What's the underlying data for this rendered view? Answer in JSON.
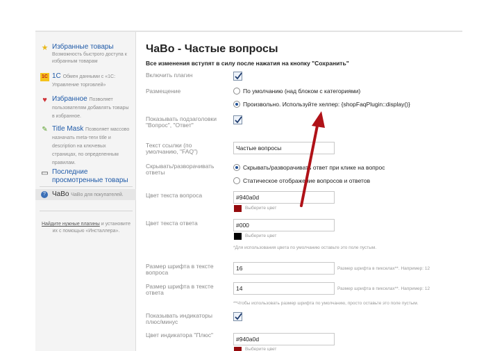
{
  "sidebar": {
    "items": [
      {
        "title": "Избранные товары",
        "desc": "Возможность быстрого доступа к избранным товарам",
        "icon": "star-icon"
      },
      {
        "title": "1С",
        "desc": "Обмен данными с «1С: Управление торговлей»",
        "icon": "1c-icon"
      },
      {
        "title": "Избранное",
        "desc": "Позволяет пользователям добавлять товары в избранное.",
        "icon": "heart-icon"
      },
      {
        "title": "Title Mask",
        "desc": "Позволяет массово назначать meta-теги title и description на ключевых страницах, по определенным правилам.",
        "icon": "mask-icon"
      },
      {
        "title": "Последние просмотренные товары",
        "desc": "",
        "icon": "monitor-icon"
      },
      {
        "title": "ЧаВо",
        "desc": "ЧаВо для покупателей.",
        "icon": "faq-icon"
      }
    ],
    "footer_link": "Найдите нужные плагины",
    "footer_text": "и установите их с помощью «Инсталлера»."
  },
  "main": {
    "title": "ЧаВо - Частые вопросы",
    "notice": "Все изменения вступят в силу после нажатия на кнопку \"Сохранить\"",
    "enable_label": "Включить плагин",
    "enable_checked": true,
    "placement_label": "Размещение",
    "placement_options": [
      "По умолчанию (над блоком с категориями)",
      "Произвольно. Используйте хелпер: {shopFaqPlugin::display()}"
    ],
    "placement_selected": 1,
    "subtitles_label": "Показывать подзаголовки \"Вопрос\", \"Ответ\"",
    "subtitles_checked": true,
    "link_text_label": "Текст ссылки (по умолчанию, \"FAQ\")",
    "link_text_value": "Частые вопросы",
    "collapse_label": "Скрывать/разворачивать ответы",
    "collapse_options": [
      "Скрывать/разворачивать ответ при клике на вопрос",
      "Статическое отображение вопросов и ответов"
    ],
    "collapse_selected": 0,
    "question_color_label": "Цвет текста вопроса",
    "question_color_value": "#940a0d",
    "answer_color_label": "Цвет текста ответа",
    "answer_color_value": "#000",
    "pick_color": "Выберите цвет",
    "color_hint": "*Для использования цвета по умолчанию оставьте это поле пустым.",
    "question_size_label": "Размер шрифта в тексте вопроса",
    "question_size_value": "16",
    "answer_size_label": "Размер шрифта в тексте ответа",
    "answer_size_value": "14",
    "size_inline_hint": "Размер шрифта в пикселах**. Например: 12",
    "size_hint": "**Чтобы использовать размер шрифта по умолчанию, просто оставьте это поле пустым.",
    "indicators_label": "Показывать индикаторы плюс/минус",
    "indicators_checked": true,
    "plus_color_label": "Цвет индикатора \"Плюс\"",
    "plus_color_value": "#940a0d"
  },
  "colors": {
    "accent": "#1f5aa8",
    "question": "#940a0d",
    "answer": "#000000",
    "arrow": "#b01218"
  }
}
